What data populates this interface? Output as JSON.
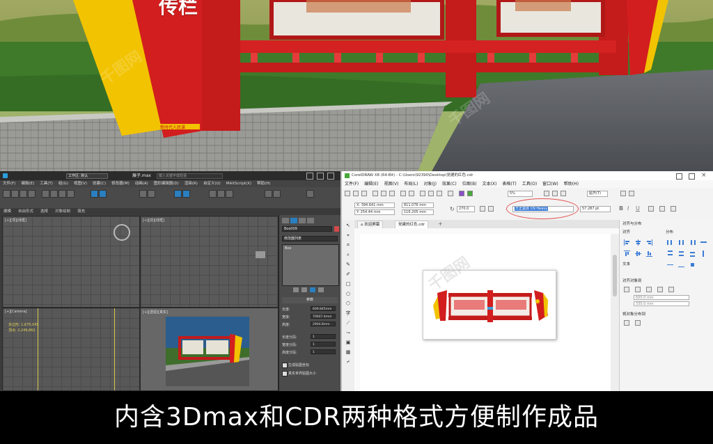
{
  "scene": {
    "sign_text": "传栏",
    "small_strip_text": "新时代人民谋"
  },
  "max": {
    "title_left": "",
    "title_file": "展子.max",
    "workspace": "工作区: 默认",
    "search_placeholder": "键入关键字或短语",
    "menu": [
      "文件(F)",
      "编辑(E)",
      "工具(T)",
      "组(G)",
      "视图(V)",
      "创建(C)",
      "修改器(M)",
      "动画(A)",
      "图形编辑器(D)",
      "渲染(R)",
      "自定义(U)",
      "MAXScript(X)",
      "帮助(H)"
    ],
    "ribbon": [
      "建模",
      "自由形式",
      "选择",
      "对象绘制",
      "填充"
    ],
    "viewport_top_left": "[+][顶][线框]",
    "viewport_top_right": "[+][前][线框]",
    "viewport_bottom_left": "[+][Camera]",
    "viewport_bottom_right": "[+][透视][真实]",
    "stats": [
      "多边形: 1,675,045",
      "顶点: 2,249,862"
    ],
    "cmd_object": "Box009",
    "cmd_modlist": "修改器列表",
    "cmd_stack_item": "Box",
    "params_title": "参数",
    "params": [
      {
        "label": "长度:",
        "value": "609.845mm"
      },
      {
        "label": "宽度:",
        "value": "70607.4mm"
      },
      {
        "label": "高度:",
        "value": "2904.8mm"
      },
      {
        "label": "长度分段:",
        "value": "1"
      },
      {
        "label": "宽度分段:",
        "value": "1"
      },
      {
        "label": "高度分段:",
        "value": "1"
      }
    ],
    "check1": "生成贴图坐标",
    "check2": "真实世界贴图大小"
  },
  "cdr": {
    "title": "CorelDRAW X8 (64-Bit) - C:\\Users\\92390\\Desktop\\党建的红色.cdr",
    "menu": [
      "文件(F)",
      "编辑(E)",
      "视图(V)",
      "布局(L)",
      "对象(J)",
      "效果(C)",
      "位图(B)",
      "文本(X)",
      "表格(T)",
      "工具(O)",
      "窗口(W)",
      "帮助(H)"
    ],
    "zoom": "5%",
    "snap": "贴齐(T)",
    "x": "X: 394.641 mm",
    "y": "Y: 254.44 mm",
    "w": "811.076 mm",
    "h": "116.205 mm",
    "angle": "270.0",
    "font": "方正黑体 CN Heavy",
    "size": "57.287 pt",
    "tab_welcome": "欢迎屏幕",
    "tab_doc": "党建的红色.cdr",
    "panel_title": "对齐与分布",
    "panel_align": "对齐",
    "panel_distribute": "分布",
    "panel_text": "文本",
    "panel_align_obj": "对齐对象到",
    "panel_dist_to": "将对象分布到",
    "px": "600.0 mm",
    "py": "330.0 mm"
  },
  "caption": "内含3Dmax和CDR两种格式方便制作成品",
  "colors": {
    "red": "#d21e1e",
    "yellow": "#f2c300",
    "accent": "#3a7bd5"
  }
}
